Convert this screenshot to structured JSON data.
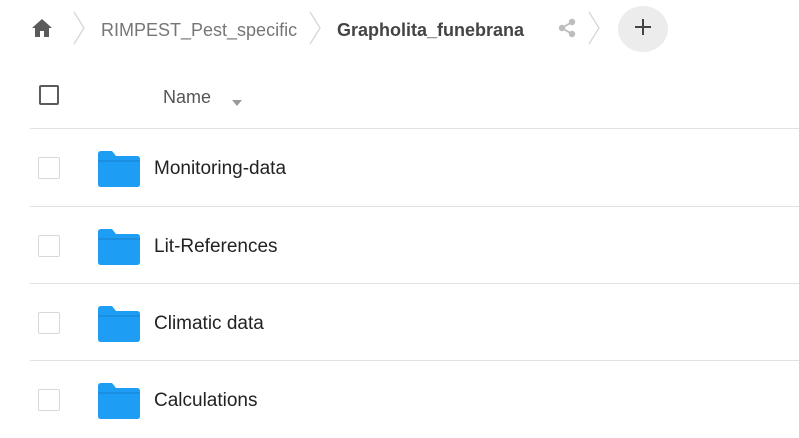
{
  "breadcrumb": {
    "home_icon": "home-icon",
    "items": [
      {
        "label": "RIMPEST_Pest_specific"
      },
      {
        "label": "Grapholita_funebrana"
      }
    ],
    "share_icon": "share-icon",
    "add_icon": "plus-icon"
  },
  "table": {
    "header": {
      "name_label": "Name",
      "sort_icon": "caret-down-icon"
    },
    "rows": [
      {
        "name": "Monitoring-data",
        "icon": "folder-icon"
      },
      {
        "name": "Lit-References",
        "icon": "folder-icon"
      },
      {
        "name": "Climatic data",
        "icon": "folder-icon"
      },
      {
        "name": "Calculations",
        "icon": "folder-icon"
      }
    ]
  },
  "colors": {
    "folder": "#1e9df4",
    "breadcrumb_link": "#767676",
    "add_button_bg": "#ececec",
    "divider": "#e2e2e2"
  }
}
